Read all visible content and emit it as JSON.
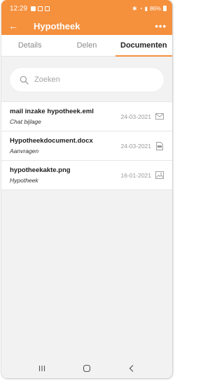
{
  "status_bar": {
    "time": "12:29",
    "battery": "86%"
  },
  "app_bar": {
    "back_icon": "arrow-left-icon",
    "title": "Hypotheek",
    "more_icon": "more-horizontal-icon",
    "color": "#f5903d"
  },
  "tabs": [
    {
      "label": "Details",
      "active": false
    },
    {
      "label": "Delen",
      "active": false
    },
    {
      "label": "Documenten",
      "active": true
    }
  ],
  "search": {
    "placeholder": "Zoeken",
    "value": ""
  },
  "documents": [
    {
      "name": "mail inzake hypotheek.eml",
      "category": "Chat bijlage",
      "date": "24-03-2021",
      "icon": "envelope-icon"
    },
    {
      "name": "Hypotheekdocument.docx",
      "category": "Aanvragen",
      "date": "24-03-2021",
      "icon": "doc-file-icon"
    },
    {
      "name": "hypotheekakte.png",
      "category": "Hypotheek",
      "date": "16-01-2021",
      "icon": "image-icon"
    }
  ],
  "nav": {
    "recents_icon": "recents-icon",
    "home_icon": "home-icon",
    "back_icon": "nav-back-icon"
  }
}
